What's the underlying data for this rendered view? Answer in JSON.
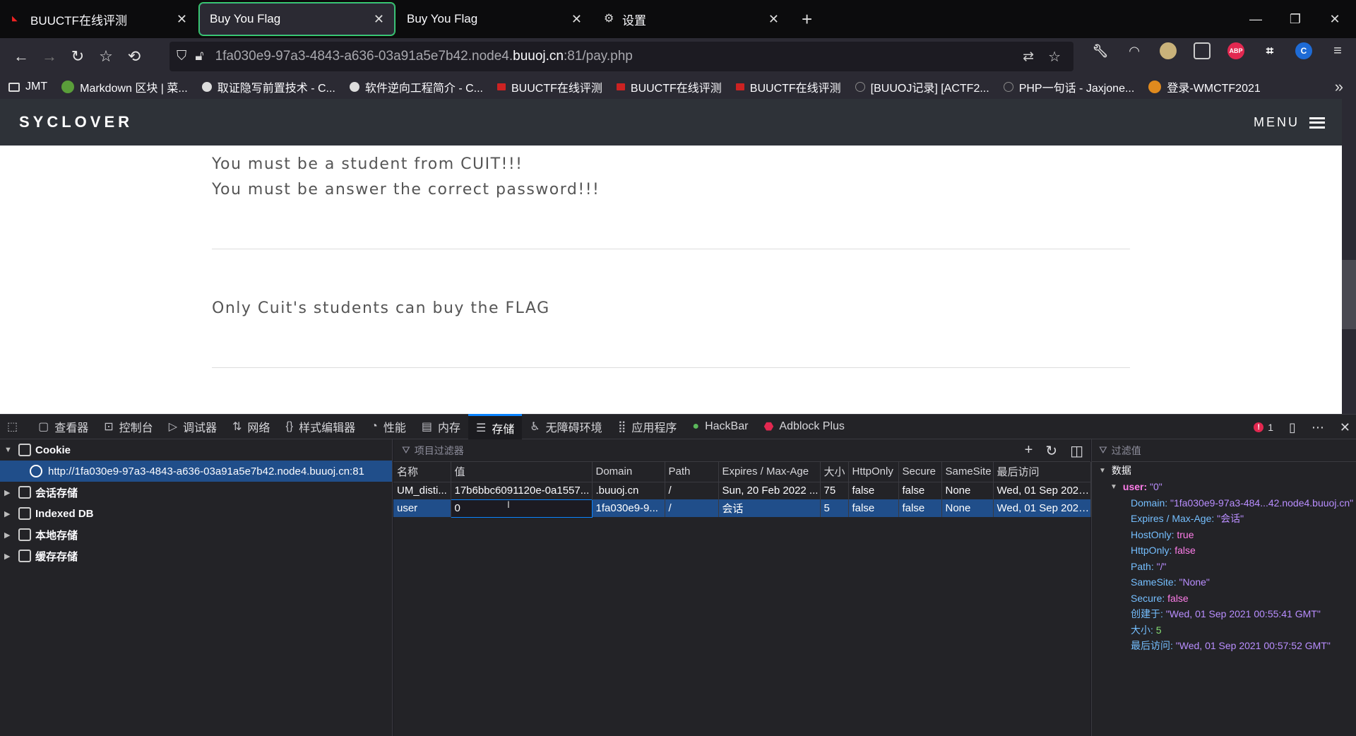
{
  "tabs": [
    {
      "title": "BUUCTF在线评测",
      "active": false
    },
    {
      "title": "Buy You Flag",
      "active": true
    },
    {
      "title": "Buy You Flag",
      "active": false
    },
    {
      "title": "设置",
      "active": false
    }
  ],
  "url": {
    "prefix": "1fa030e9-97a3-4843-a636-03a91a5e7b42.node4.",
    "domain": "buuoj.cn",
    "suffix": ":81/pay.php"
  },
  "bookmarks": [
    "JMT",
    "Markdown 区块 | 菜...",
    "取证隐写前置技术 - C...",
    "软件逆向工程简介 - C...",
    "BUUCTF在线评测",
    "BUUCTF在线评测",
    "BUUCTF在线评测",
    "[BUUOJ记录] [ACTF2...",
    "PHP一句话 - Jaxjone...",
    "登录-WMCTF2021"
  ],
  "site": {
    "logo": "SYCLOVER",
    "menu": "MENU",
    "lines": [
      "You must be a student from CUIT!!!",
      "You must be answer the correct password!!!",
      "Only Cuit's students can buy the FLAG"
    ]
  },
  "devtools": {
    "tabs": [
      "查看器",
      "控制台",
      "调试器",
      "网络",
      "样式编辑器",
      "性能",
      "内存",
      "存储",
      "无障碍环境",
      "应用程序",
      "HackBar",
      "Adblock Plus"
    ],
    "active_tab": "存储",
    "error_count": "1",
    "tree": {
      "cookie": "Cookie",
      "cookie_host": "http://1fa030e9-97a3-4843-a636-03a91a5e7b42.node4.buuoj.cn:81",
      "session": "会话存储",
      "indexed": "Indexed DB",
      "local": "本地存储",
      "cache": "缓存存储"
    },
    "filter_placeholder": "项目过滤器",
    "columns": [
      "名称",
      "值",
      "Domain",
      "Path",
      "Expires / Max-Age",
      "大小",
      "HttpOnly",
      "Secure",
      "SameSite",
      "最后访问"
    ],
    "rows": [
      [
        "UM_disti...",
        "17b6bbc6091120e-0a1557...",
        ".buuoj.cn",
        "/",
        "Sun, 20 Feb 2022 ...",
        "75",
        "false",
        "false",
        "None",
        "Wed, 01 Sep 2021..."
      ],
      [
        "user",
        "0",
        "1fa030e9-9...",
        "/",
        "会话",
        "5",
        "false",
        "false",
        "None",
        "Wed, 01 Sep 2021..."
      ]
    ],
    "sidebar": {
      "filter_placeholder": "过滤值",
      "section": "数据",
      "item_key": "user",
      "item_value": "\"0\"",
      "props": [
        {
          "k": "Domain",
          "v": "\"1fa030e9-97a3-484...42.node4.buuoj.cn\""
        },
        {
          "k": "Expires / Max-Age",
          "v": "\"会话\""
        },
        {
          "k": "HostOnly",
          "v": "true"
        },
        {
          "k": "HttpOnly",
          "v": "false"
        },
        {
          "k": "Path",
          "v": "\"/\""
        },
        {
          "k": "SameSite",
          "v": "\"None\""
        },
        {
          "k": "Secure",
          "v": "false"
        },
        {
          "k": "创建于",
          "v": "\"Wed, 01 Sep 2021 00:55:41 GMT\""
        },
        {
          "k": "大小",
          "v": "5"
        },
        {
          "k": "最后访问",
          "v": "\"Wed, 01 Sep 2021 00:57:52 GMT\""
        }
      ]
    }
  }
}
